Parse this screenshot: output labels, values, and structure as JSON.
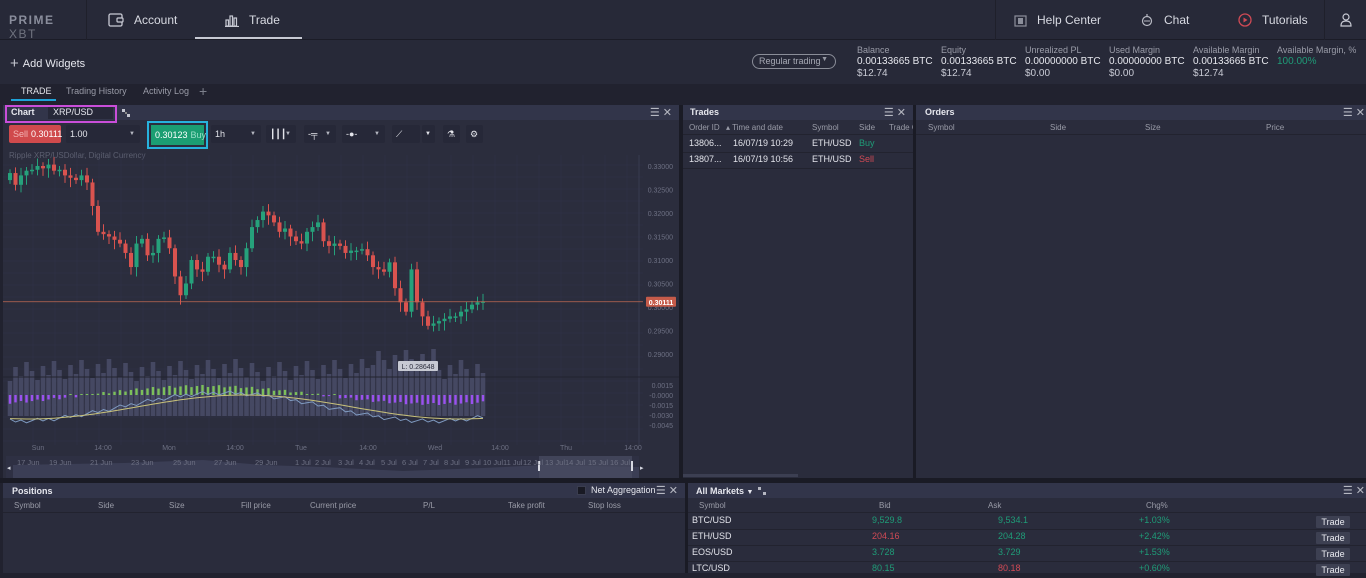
{
  "nav": {
    "logo_main": "PRIME",
    "logo_sub": "XBT",
    "account": "Account",
    "trade": "Trade",
    "help_center": "Help Center",
    "chat": "Chat",
    "tutorials": "Tutorials"
  },
  "toolbar": {
    "add_widgets": "Add Widgets",
    "trading_mode": "Regular trading"
  },
  "account_stats": [
    {
      "label": "Balance",
      "btc": "0.00133665 BTC",
      "usd": "$12.74"
    },
    {
      "label": "Equity",
      "btc": "0.00133665 BTC",
      "usd": "$12.74"
    },
    {
      "label": "Unrealized PL",
      "btc": "0.00000000 BTC",
      "usd": "$0.00"
    },
    {
      "label": "Used Margin",
      "btc": "0.00000000 BTC",
      "usd": "$0.00"
    },
    {
      "label": "Available Margin",
      "btc": "0.00133665 BTC",
      "usd": "$12.74"
    },
    {
      "label": "Available Margin, %",
      "value": "100.00%"
    }
  ],
  "tabs": [
    {
      "label": "TRADE",
      "active": true
    },
    {
      "label": "Trading History",
      "active": false
    },
    {
      "label": "Activity Log",
      "active": false
    }
  ],
  "chart_widget": {
    "title": "Chart",
    "symbol": "XRP/USD",
    "sell_label": "Sell",
    "sell_price": "0.30111",
    "quantity": "1.00",
    "buy_price": "0.30123",
    "buy_label": "Buy",
    "interval": "1h",
    "description": "Ripple XRP/USDollar, Digital Currency",
    "current_price_tag": "0.30111",
    "low_tag": "L: 0.28648",
    "price_axis": [
      "0.33000",
      "0.32500",
      "0.32000",
      "0.31500",
      "0.31000",
      "0.30500",
      "0.30000",
      "0.29500",
      "0.29000"
    ],
    "macd_axis": [
      "0.0015",
      "-0.0000",
      "-0.0015",
      "-0.0030",
      "-0.0045"
    ],
    "time_axis": [
      "Sun",
      "14:00",
      "Mon",
      "14:00",
      "Tue",
      "14:00",
      "Wed",
      "14:00",
      "Thu",
      "14:00"
    ],
    "navigator_dates": [
      "17 Jun",
      "19 Jun",
      "21 Jun",
      "23 Jun",
      "25 Jun",
      "27 Jun",
      "29 Jun",
      "1 Jul",
      "2 Jul",
      "3 Jul",
      "4 Jul",
      "5 Jul",
      "6 Jul",
      "7 Jul",
      "8 Jul",
      "9 Jul",
      "10 Jul",
      "11 Jul",
      "12 Jul",
      "13 Jul",
      "14 Jul",
      "15 Jul",
      "16 Jul"
    ],
    "colors": {
      "up": "#26a17b",
      "down": "#d9534f",
      "volume": "#4a4e69",
      "macd_pos": "#7cc05a",
      "macd_neg": "#9b51f0",
      "macd_line": "#7f9ac0",
      "signal_line": "#c9c27a"
    }
  },
  "trades": {
    "title": "Trades",
    "columns": [
      "Order ID",
      "Time and date",
      "Symbol",
      "Side",
      "Trade C"
    ],
    "rows": [
      {
        "order_id": "13806...",
        "time": "16/07/19 10:29",
        "symbol": "ETH/USD",
        "side": "Buy"
      },
      {
        "order_id": "13807...",
        "time": "16/07/19 10:56",
        "symbol": "ETH/USD",
        "side": "Sell"
      }
    ]
  },
  "orders": {
    "title": "Orders",
    "columns": [
      "Symbol",
      "Side",
      "Size",
      "Price"
    ]
  },
  "positions": {
    "title": "Positions",
    "net_aggregation": "Net Aggregation",
    "columns": [
      "Symbol",
      "Side",
      "Size",
      "Fill price",
      "Current price",
      "P/L",
      "Take profit",
      "Stop loss"
    ]
  },
  "markets": {
    "title": "All Markets",
    "columns": [
      "Symbol",
      "Bid",
      "Ask",
      "Chg%"
    ],
    "trade_label": "Trade",
    "rows": [
      {
        "symbol": "BTC/USD",
        "bid": "9,529.8",
        "ask": "9,534.1",
        "chg": "+1.03%",
        "bid_dir": "up",
        "ask_dir": "up"
      },
      {
        "symbol": "ETH/USD",
        "bid": "204.16",
        "ask": "204.28",
        "chg": "+2.42%",
        "bid_dir": "down",
        "ask_dir": "up"
      },
      {
        "symbol": "EOS/USD",
        "bid": "3.728",
        "ask": "3.729",
        "chg": "+1.53%",
        "bid_dir": "up",
        "ask_dir": "up"
      },
      {
        "symbol": "LTC/USD",
        "bid": "80.15",
        "ask": "80.18",
        "chg": "+0.60%",
        "bid_dir": "up",
        "ask_dir": "down"
      }
    ]
  }
}
